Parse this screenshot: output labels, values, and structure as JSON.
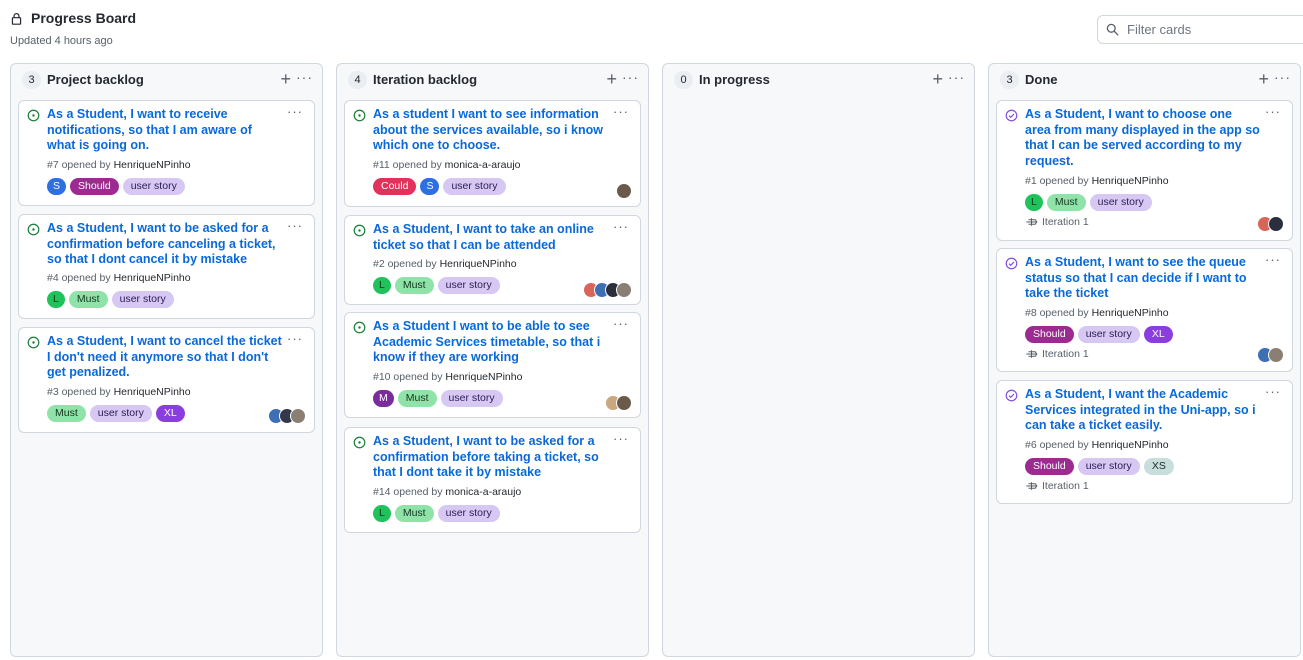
{
  "header": {
    "title": "Progress Board",
    "updated": "Updated 4 hours ago"
  },
  "filter": {
    "placeholder": "Filter cards"
  },
  "columns": [
    {
      "count": "3",
      "title": "Project backlog",
      "cards": [
        {
          "title": "As a Student, I want to receive notifications, so that I am aware of what is going on.",
          "number": "#7 opened by ",
          "user": "HenriqueNPinho",
          "labels": [
            "S",
            "Should",
            "user story"
          ]
        },
        {
          "title": "As a Student, I want to be asked for a confirmation before canceling a ticket, so that I dont cancel it by mistake",
          "number": "#4 opened by ",
          "user": "HenriqueNPinho",
          "labels": [
            "L",
            "Must",
            "user story"
          ]
        },
        {
          "title": "As a Student, I want to cancel the ticket I don't need it anymore so that I don't get penalized.",
          "number": "#3 opened by ",
          "user": "HenriqueNPinho",
          "labels": [
            "Must",
            "user story",
            "XL"
          ]
        }
      ]
    },
    {
      "count": "4",
      "title": "Iteration backlog",
      "cards": [
        {
          "title": "As a student I want to see information about the services available, so i know which one to choose.",
          "number": "#11 opened by ",
          "user": "monica-a-araujo",
          "labels": [
            "Could",
            "S",
            "user story"
          ]
        },
        {
          "title": "As a Student, I want to take an online ticket so that I can be attended",
          "number": "#2 opened by ",
          "user": "HenriqueNPinho",
          "labels": [
            "L",
            "Must",
            "user story"
          ]
        },
        {
          "title": "As a Student I want to be able to see Academic Services timetable, so that i know if they are working",
          "number": "#10 opened by ",
          "user": "HenriqueNPinho",
          "labels": [
            "M",
            "Must",
            "user story"
          ]
        },
        {
          "title": "As a Student, I want to be asked for a confirmation before taking a ticket, so that I dont take it by mistake",
          "number": "#14 opened by ",
          "user": "monica-a-araujo",
          "labels": [
            "L",
            "Must",
            "user story"
          ]
        }
      ]
    },
    {
      "count": "0",
      "title": "In progress",
      "cards": []
    },
    {
      "count": "3",
      "title": "Done",
      "cards": [
        {
          "title": "As a Student, I want to choose one area from many displayed in the app so that I can be served according to my request.",
          "number": "#1 opened by ",
          "user": "HenriqueNPinho",
          "labels": [
            "L",
            "Must",
            "user story"
          ],
          "iteration": "Iteration 1"
        },
        {
          "title": "As a Student, I want to see the queue status so that I can decide if I want to take the ticket",
          "number": "#8 opened by ",
          "user": "HenriqueNPinho",
          "labels": [
            "Should",
            "user story",
            "XL"
          ],
          "iteration": "Iteration 1"
        },
        {
          "title": "As a Student, I want the Academic Services integrated in the Uni-app, so i can take a ticket easily.",
          "number": "#6 opened by ",
          "user": "HenriqueNPinho",
          "labels": [
            "Should",
            "user story",
            "XS"
          ],
          "iteration": "Iteration 1"
        }
      ]
    }
  ],
  "icons": {
    "open": "issue-opened-icon",
    "closed": "issue-closed-icon",
    "lock": "lock-icon",
    "search": "search-icon",
    "iteration": "iteration-icon"
  },
  "colors": {
    "link": "#0969da",
    "open_icon": "#1a7f37",
    "closed_icon": "#8250df"
  }
}
